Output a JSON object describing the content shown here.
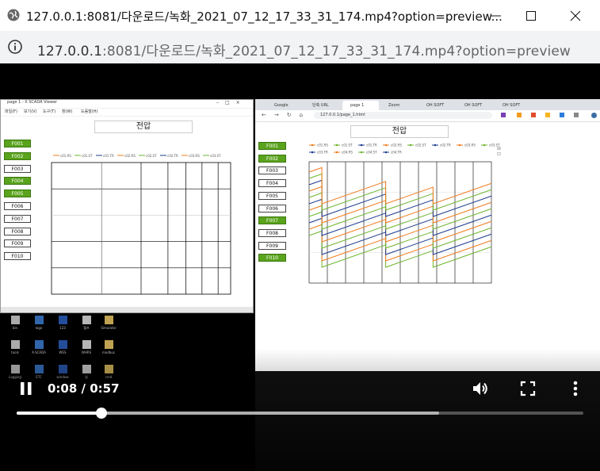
{
  "window": {
    "title": "127.0.0.1:8081/다운로드/녹화_2021_07_12_17_33_31_174.mp4?option=preview...",
    "url_host": "127.0.0.1",
    "url_rest": ":8081/다운로드/녹화_2021_07_12_17_33_31_174.mp4?option=preview"
  },
  "player": {
    "time": "0:08 / 0:57",
    "progress_fraction": 0.149,
    "buffered_fraction": 0.746
  },
  "left_app": {
    "window_title": "page 1 - X SCADA Viewer",
    "menu": [
      "파일(F)",
      "보기(V)",
      "도구(T)",
      "창(W)",
      "도움말(H)"
    ],
    "page_title": "전압",
    "buttons": [
      {
        "label": "F001",
        "active": true
      },
      {
        "label": "F002",
        "active": true
      },
      {
        "label": "F003",
        "active": false
      },
      {
        "label": "F004",
        "active": true
      },
      {
        "label": "F005",
        "active": true
      },
      {
        "label": "F006",
        "active": false
      },
      {
        "label": "F007",
        "active": false
      },
      {
        "label": "F008",
        "active": false
      },
      {
        "label": "F009",
        "active": false
      },
      {
        "label": "F010",
        "active": false
      }
    ],
    "legend": [
      "c01.RS",
      "c01.ST",
      "c01.TR",
      "c02.RS",
      "c02.ST",
      "c02.TR",
      "c03.RS",
      "c03.ST"
    ]
  },
  "browser": {
    "tabs": [
      "Google",
      "단축 URL",
      "page 1",
      "Zoom",
      "OH SOFT",
      "OH SOFT",
      "OH SOFT"
    ],
    "url": "127.0.0.1/page_1.html",
    "page_title": "전압",
    "buttons": [
      {
        "label": "F001",
        "active": true
      },
      {
        "label": "F002",
        "active": true
      },
      {
        "label": "F003",
        "active": false
      },
      {
        "label": "F004",
        "active": false
      },
      {
        "label": "F005",
        "active": false
      },
      {
        "label": "F006",
        "active": false
      },
      {
        "label": "F007",
        "active": true
      },
      {
        "label": "F008",
        "active": false
      },
      {
        "label": "F009",
        "active": false
      },
      {
        "label": "F010",
        "active": true
      }
    ],
    "legend": [
      "c01.RS",
      "c01.ST",
      "c01.TR",
      "c02.RS",
      "c02.ST",
      "c02.TR",
      "c03.RS",
      "c03.ST",
      "c03.TR",
      "c04.RS",
      "c04.ST",
      "c04.TR"
    ]
  },
  "desktop_icons": [
    "bin",
    "logo",
    "123",
    "헬프",
    "Simulator",
    "tools",
    "X-SCADA",
    "WSS",
    "WHRS",
    "modbus",
    "Logging",
    "ETC",
    "window",
    "일",
    "cmd"
  ],
  "colors": {
    "green": "#6eb52f",
    "orange": "#f07c1f",
    "navy": "#1f3b8f",
    "accent_green_button": "#5aa31d"
  },
  "icons": {
    "globe": "globe-icon",
    "info": "info-icon",
    "pause": "pause-icon",
    "volume": "volume-icon",
    "fullscreen": "fullscreen-icon",
    "more": "more-vert-icon"
  }
}
